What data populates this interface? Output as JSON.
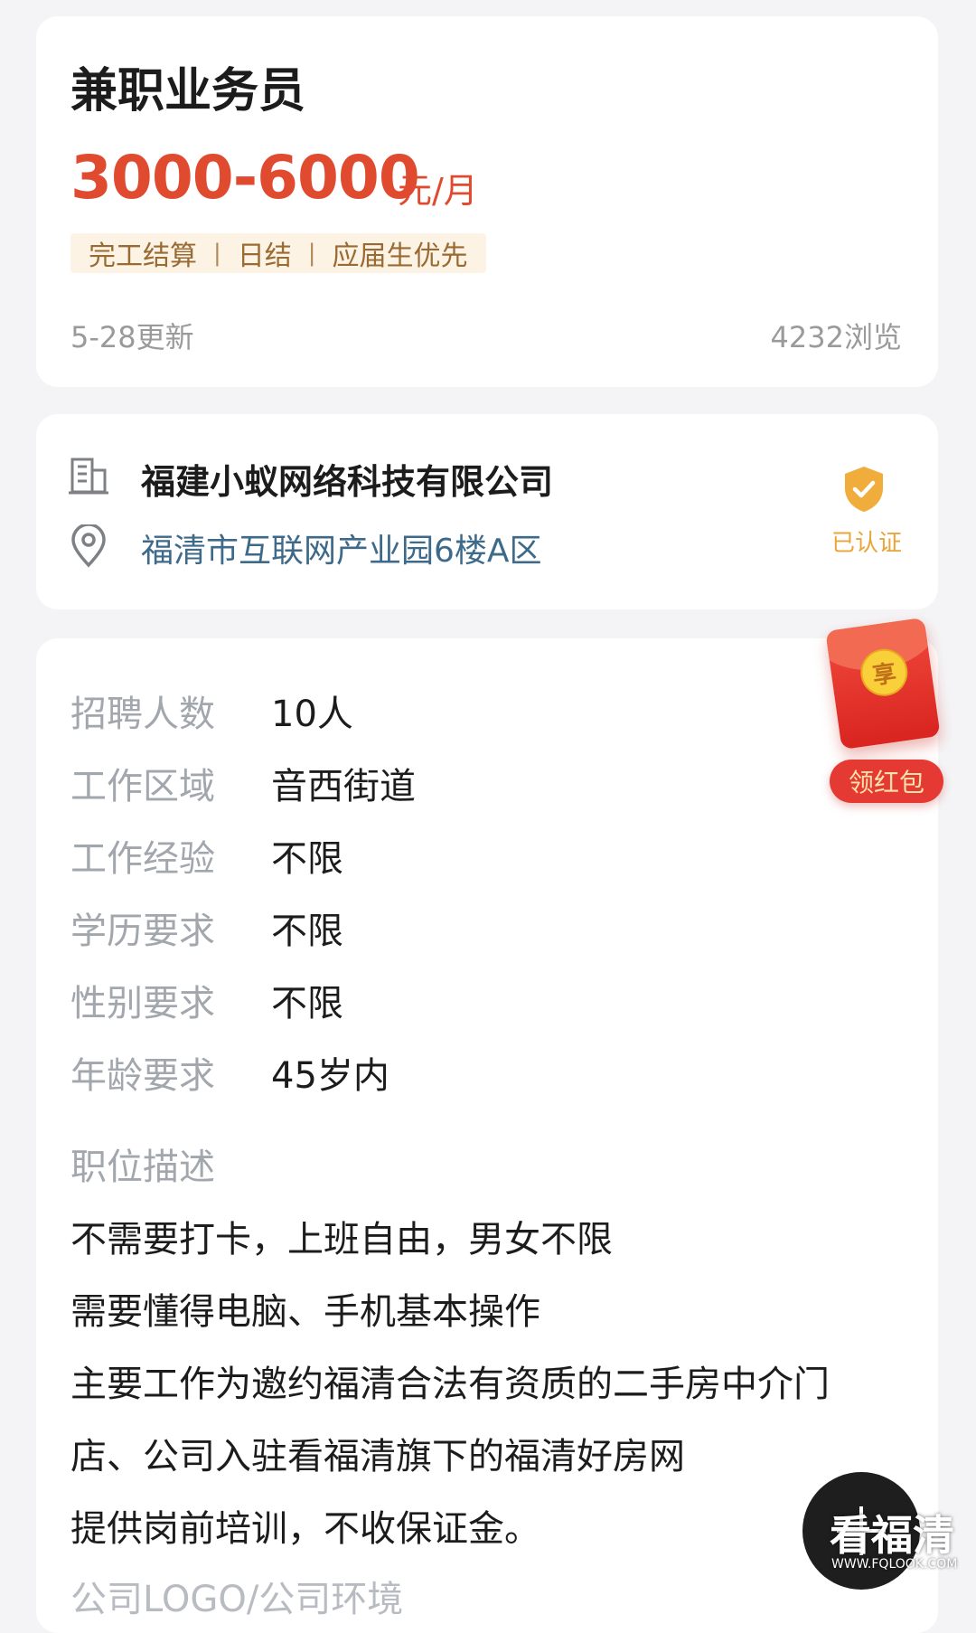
{
  "job": {
    "title": "兼职业务员",
    "salary": "3000-6000",
    "salary_unit": "元/月",
    "tags": [
      "完工结算",
      "日结",
      "应届生优先"
    ],
    "updated": "5-28更新",
    "views": "4232浏览"
  },
  "company": {
    "name": "福建小蚁网络科技有限公司",
    "address": "福清市互联网产业园6楼A区",
    "verified_label": "已认证",
    "building_icon": "building-icon",
    "location_icon": "location-pin-icon",
    "verified_icon": "shield-check-icon"
  },
  "details": [
    {
      "label": "招聘人数",
      "value": "10人"
    },
    {
      "label": "工作区域",
      "value": "音西街道"
    },
    {
      "label": "工作经验",
      "value": "不限"
    },
    {
      "label": "学历要求",
      "value": "不限"
    },
    {
      "label": "性别要求",
      "value": "不限"
    },
    {
      "label": "年龄要求",
      "value": "45岁内"
    }
  ],
  "description": {
    "label": "职位描述",
    "lines": [
      "不需要打卡，上班自由，男女不限",
      "需要懂得电脑、手机基本操作",
      "主要工作为邀约福清合法有资质的二手房中介门",
      "店、公司入驻看福清旗下的福清好房网",
      "提供岗前培训，不收保证金。"
    ]
  },
  "logo_section_label": "公司LOGO/公司环境",
  "red_packet": {
    "coin_text": "享",
    "button_label": "领红包"
  },
  "watermark": {
    "main": "看福清",
    "sub": "WWW.FQLOOK.COM"
  },
  "colors": {
    "accent_red": "#e04a2f",
    "tag_bg": "#fcf3e5",
    "tag_text": "#9a6a33",
    "address_blue": "#3d6a8a",
    "verified_orange": "#e9a53a"
  }
}
